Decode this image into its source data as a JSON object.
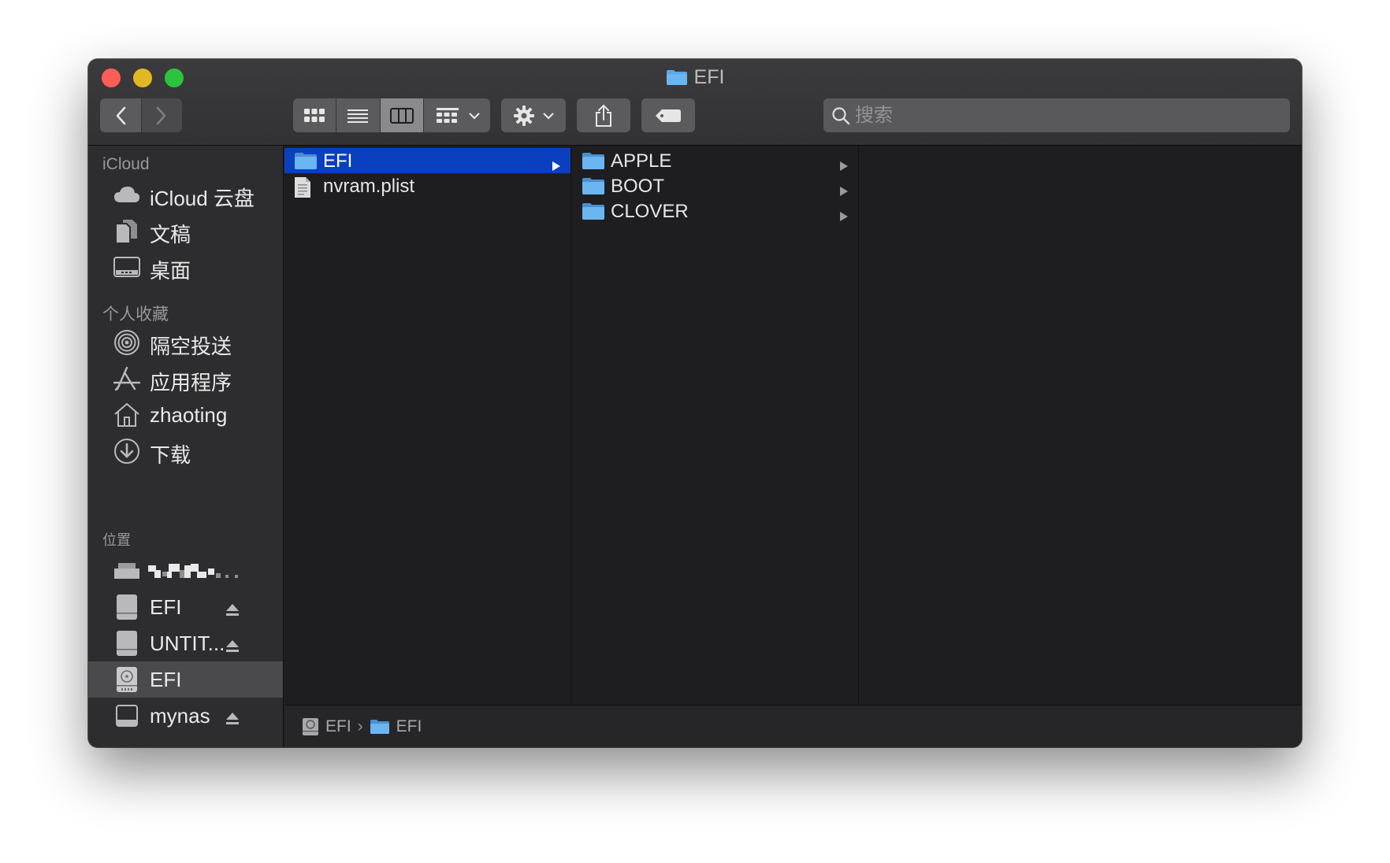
{
  "window": {
    "title": "EFI"
  },
  "toolbar": {
    "view_mode": "columns",
    "search_placeholder": "搜索"
  },
  "sidebar": {
    "sections": [
      {
        "title": "iCloud",
        "items": [
          {
            "label": "iCloud 云盘",
            "icon": "cloud-icon"
          },
          {
            "label": "文稿",
            "icon": "documents-icon"
          },
          {
            "label": "桌面",
            "icon": "desktop-icon"
          }
        ]
      },
      {
        "title": "个人收藏",
        "items": [
          {
            "label": "隔空投送",
            "icon": "airdrop-icon"
          },
          {
            "label": "应用程序",
            "icon": "applications-icon"
          },
          {
            "label": "zhaoting",
            "icon": "home-icon"
          },
          {
            "label": "下载",
            "icon": "downloads-icon"
          }
        ]
      },
      {
        "title": "位置",
        "items": [
          {
            "label": "",
            "icon": "computer-icon"
          },
          {
            "label": "EFI",
            "icon": "external-disk-icon",
            "eject": true
          },
          {
            "label": "UNTIT...",
            "icon": "external-disk-icon",
            "eject": true
          },
          {
            "label": "EFI",
            "icon": "internal-disk-icon",
            "selected": true
          },
          {
            "label": "mynas",
            "icon": "server-icon",
            "eject": true
          }
        ]
      }
    ]
  },
  "columns": [
    {
      "items": [
        {
          "label": "EFI",
          "type": "folder",
          "selected": true,
          "has_children": true
        },
        {
          "label": "nvram.plist",
          "type": "plist-file"
        }
      ]
    },
    {
      "items": [
        {
          "label": "APPLE",
          "type": "folder",
          "has_children": true
        },
        {
          "label": "BOOT",
          "type": "folder",
          "has_children": true
        },
        {
          "label": "CLOVER",
          "type": "folder",
          "has_children": true
        }
      ]
    },
    {
      "items": []
    }
  ],
  "pathbar": [
    {
      "label": "EFI",
      "icon": "internal-disk-icon"
    },
    {
      "label": "EFI",
      "icon": "folder-icon"
    }
  ],
  "colors": {
    "selection": "#0a3fbf",
    "folder": "#5ba8e8",
    "close": "#fd5e57",
    "minimize": "#e2b724",
    "maximize": "#2cc33d"
  }
}
